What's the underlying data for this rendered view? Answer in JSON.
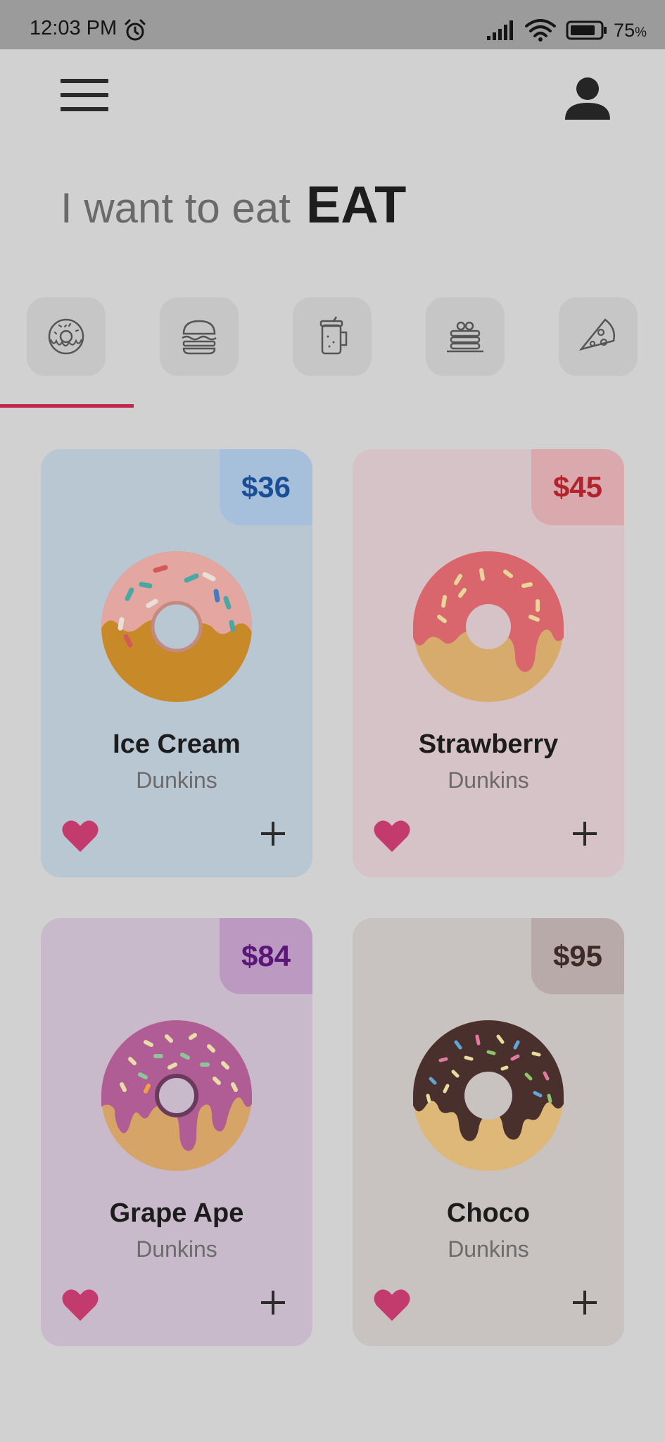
{
  "status_bar": {
    "time": "12:03 PM",
    "alarm_icon": "alarm-clock-icon",
    "signal_icon": "cell-signal-icon",
    "wifi_icon": "wifi-icon",
    "battery_icon": "battery-icon",
    "battery_value": "75",
    "battery_unit": "%"
  },
  "header": {
    "menu_icon": "hamburger-menu-icon",
    "profile_icon": "user-profile-icon"
  },
  "headline": {
    "prefix": "I want to eat",
    "emphasis": "EAT"
  },
  "categories": [
    {
      "icon": "donut-icon",
      "selected": true
    },
    {
      "icon": "burger-icon",
      "selected": false
    },
    {
      "icon": "drink-jar-icon",
      "selected": false
    },
    {
      "icon": "pancakes-icon",
      "selected": false
    },
    {
      "icon": "pizza-slice-icon",
      "selected": false
    }
  ],
  "accent_color": "#c0264f",
  "products": [
    {
      "name": "Ice Cream",
      "brand": "Dunkins",
      "price": "$36",
      "card_color": "#b9c7d2",
      "tag_color": "#a6c0dc",
      "price_color": "#1a4f96"
    },
    {
      "name": "Strawberry",
      "brand": "Dunkins",
      "price": "$45",
      "card_color": "#d5c3c7",
      "tag_color": "#d9a9ae",
      "price_color": "#b3232c"
    },
    {
      "name": "Grape Ape",
      "brand": "Dunkins",
      "price": "$84",
      "card_color": "#c9bacb",
      "tag_color": "#bc99c0",
      "price_color": "#5a1778"
    },
    {
      "name": "Choco",
      "brand": "Dunkins",
      "price": "$95",
      "card_color": "#c8c2c1",
      "tag_color": "#b8aaa8",
      "price_color": "#3d2a27"
    }
  ]
}
